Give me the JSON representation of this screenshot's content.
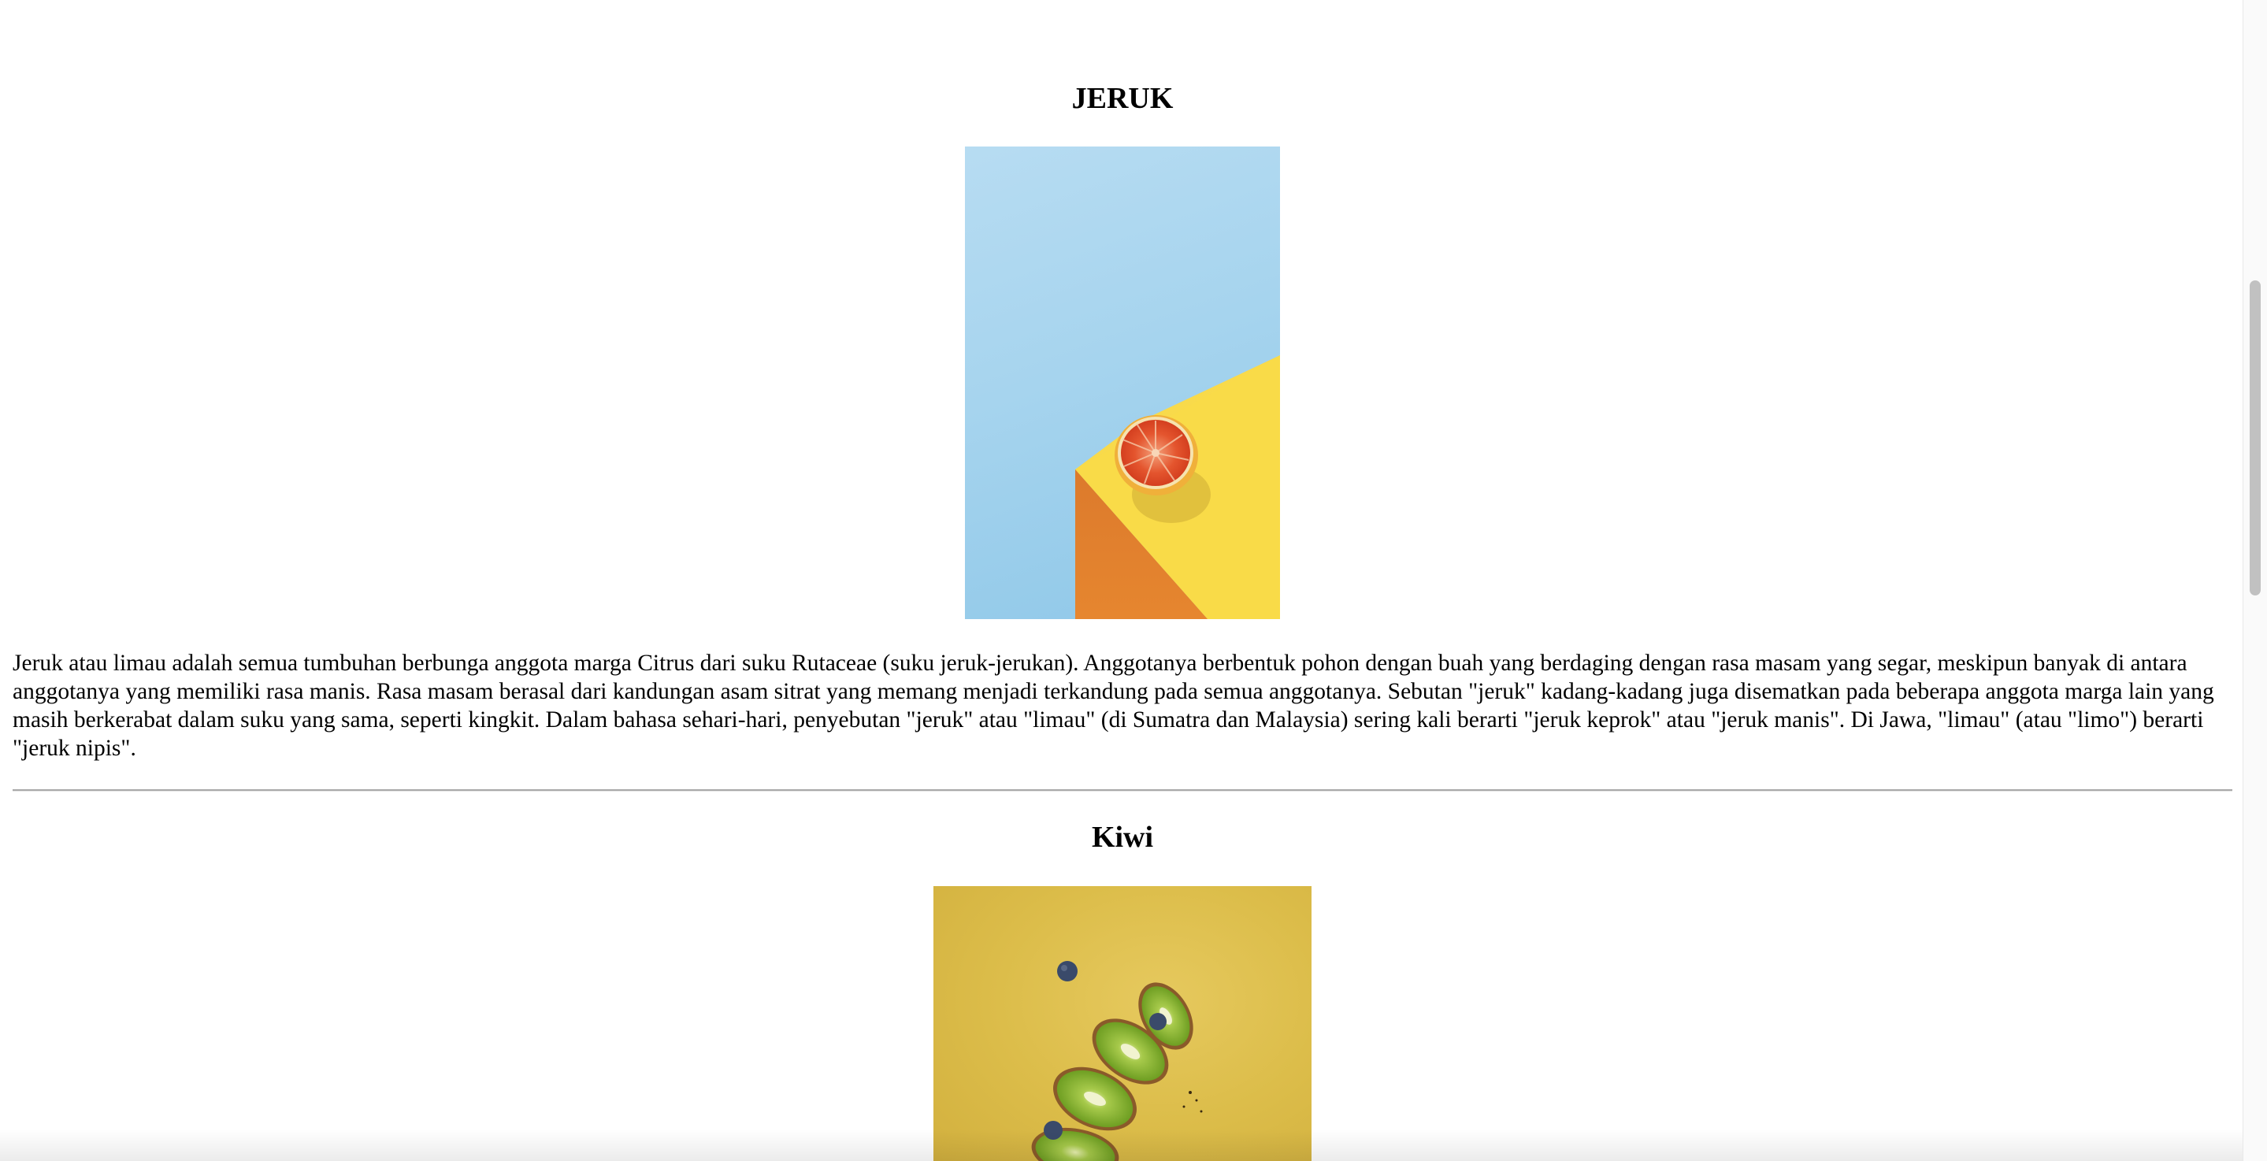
{
  "sections": [
    {
      "title": "JERUK",
      "image_subject": "half-grapefruit-on-yellow-block",
      "description": "Jeruk atau limau adalah semua tumbuhan berbunga anggota marga Citrus dari suku Rutaceae (suku jeruk-jerukan). Anggotanya berbentuk pohon dengan buah yang berdaging dengan rasa masam yang segar, meskipun banyak di antara anggotanya yang memiliki rasa manis. Rasa masam berasal dari kandungan asam sitrat yang memang menjadi terkandung pada semua anggotanya. Sebutan \"jeruk\" kadang-kadang juga disematkan pada beberapa anggota marga lain yang masih berkerabat dalam suku yang sama, seperti kingkit. Dalam bahasa sehari-hari, penyebutan \"jeruk\" atau \"limau\" (di Sumatra dan Malaysia) sering kali berarti \"jeruk keprok\" atau \"jeruk manis\". Di Jawa, \"limau\" (atau \"limo\") berarti \"jeruk nipis\"."
    },
    {
      "title": "Kiwi",
      "image_subject": "sliced-kiwi-with-blueberries"
    }
  ],
  "colors": {
    "sky_blue": "#a6d4ee",
    "block_yellow": "#f8d94a",
    "block_orange": "#e2822f",
    "fruit_red": "#e04a26",
    "kiwi_background": "#dcbd4a",
    "kiwi_green": "#7cae2a",
    "blueberry": "#3a4a6a",
    "divider": "#a9a9a9",
    "scrollbar_thumb": "#c1c1c1"
  }
}
